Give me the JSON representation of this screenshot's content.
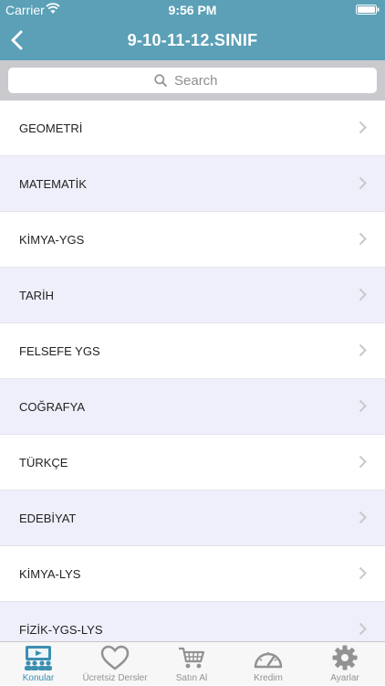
{
  "status_bar": {
    "carrier": "Carrier",
    "time": "9:56 PM"
  },
  "nav": {
    "title": "9-10-11-12.SINIF"
  },
  "search": {
    "placeholder": "Search"
  },
  "subjects": [
    "GEOMETRİ",
    "MATEMATİK",
    "KİMYA-YGS",
    "TARİH",
    "FELSEFE YGS",
    "COĞRAFYA",
    "TÜRKÇE",
    "EDEBİYAT",
    "KİMYA-LYS",
    "FİZİK-YGS-LYS"
  ],
  "tabs": [
    {
      "label": "Konular",
      "icon": "classroom-icon",
      "active": true
    },
    {
      "label": "Ücretsiz Dersler",
      "icon": "heart-icon",
      "active": false
    },
    {
      "label": "Satın Al",
      "icon": "cart-icon",
      "active": false
    },
    {
      "label": "Kredim",
      "icon": "gauge-icon",
      "active": false
    },
    {
      "label": "Ayarlar",
      "icon": "gear-icon",
      "active": false
    }
  ],
  "colors": {
    "nav_background": "#5ba0b7",
    "row_alt_background": "#efeffb",
    "tab_active": "#3b8fb0",
    "tab_inactive": "#929292"
  }
}
